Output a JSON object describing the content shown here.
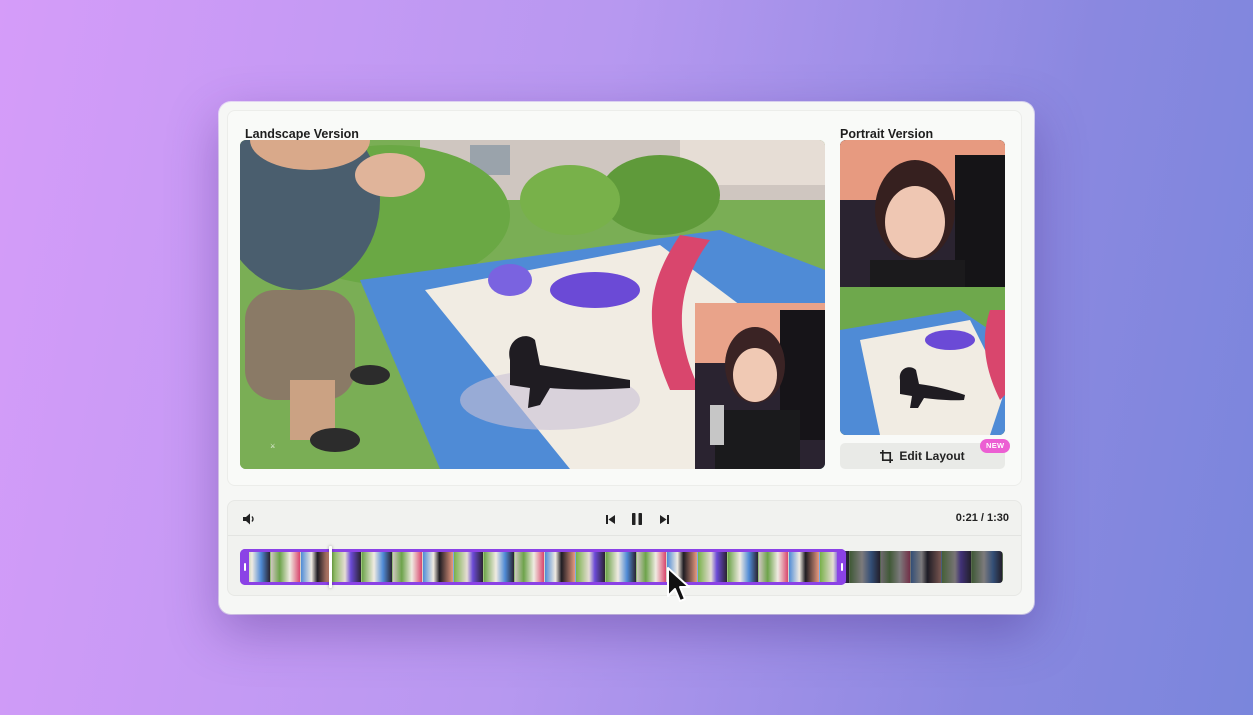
{
  "landscape": {
    "title": "Landscape Version"
  },
  "portrait": {
    "title": "Portrait Version",
    "edit_label": "Edit Layout",
    "badge": "NEW"
  },
  "player": {
    "time": "0:21 / 1:30",
    "progress": 0.233,
    "selection_end_fraction": 0.794
  },
  "icons": {
    "volume": "volume-icon",
    "previous": "skip-back-icon",
    "pause": "pause-icon",
    "next": "skip-forward-icon",
    "crop": "crop-icon",
    "cursor": "mouse-pointer-icon"
  },
  "colors": {
    "accent": "#8b42e6",
    "badge": "#ec5fd3",
    "background_start": "#d59cf9",
    "background_end": "#7a86dc"
  }
}
